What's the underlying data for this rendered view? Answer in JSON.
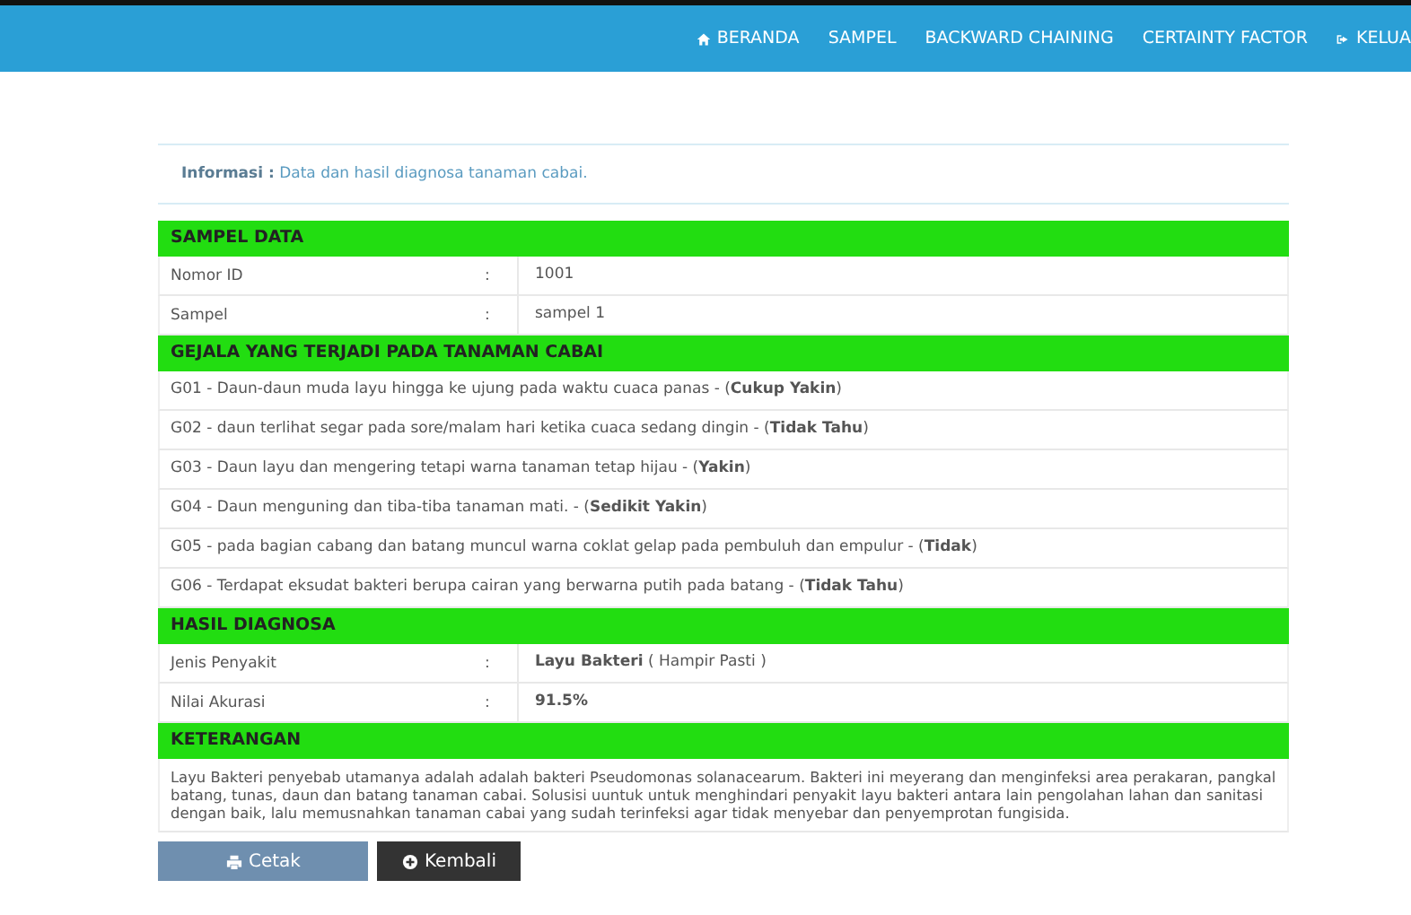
{
  "nav": [
    {
      "label": "BERANDA",
      "kind": "home"
    },
    {
      "label": "SAMPEL",
      "kind": "plain"
    },
    {
      "label": "BACKWARD CHAINING",
      "kind": "plain"
    },
    {
      "label": "CERTAINTY FACTOR",
      "kind": "plain"
    },
    {
      "label": "KELUA",
      "kind": "logout"
    }
  ],
  "info": {
    "label": "Informasi :",
    "text": "Data dan hasil diagnosa tanaman cabai."
  },
  "sampel": {
    "title": "SAMPEL DATA",
    "rows": [
      {
        "label": "Nomor ID",
        "sep": ":",
        "value": "1001"
      },
      {
        "label": "Sampel",
        "sep": ":",
        "value": "sampel 1"
      }
    ]
  },
  "gejala": {
    "title": "GEJALA YANG TERJADI PADA TANAMAN CABAI",
    "items": [
      "G01 - Daun-daun muda layu hingga ke ujung pada waktu cuaca panas - (**Cukup Yakin**)",
      "G02 - daun terlihat segar pada sore/malam hari ketika cuaca sedang dingin - (**Tidak Tahu**)",
      "G03 - Daun layu dan mengering tetapi warna tanaman tetap hijau - (**Yakin**)",
      "G04 - Daun menguning dan tiba-tiba tanaman mati. - (**Sedikit Yakin**)",
      "G05 - pada bagian cabang dan batang muncul warna coklat gelap pada pembuluh dan empulur - (**Tidak**)",
      "G06 - Terdapat eksudat bakteri berupa cairan yang berwarna putih pada batang - (**Tidak Tahu**)"
    ]
  },
  "hasil": {
    "title": "HASIL DIAGNOSA",
    "rows": [
      {
        "label": "Jenis Penyakit",
        "sep": ":",
        "value": "**Layu Bakteri** ( Hampir Pasti )"
      },
      {
        "label": "Nilai Akurasi",
        "sep": ":",
        "value": "**91.5%**"
      }
    ]
  },
  "keterangan": {
    "title": "KETERANGAN",
    "text": "Layu Bakteri penyebab utamanya adalah adalah bakteri Pseudomonas solanacearum. Bakteri ini meyerang dan menginfeksi area perakaran, pangkal batang, tunas, daun dan batang tanaman cabai. Solusisi uuntuk untuk menghindari penyakit layu bakteri antara lain pengolahan lahan dan sanitasi dengan baik, lalu memusnahkan tanaman cabai yang sudah terinfeksi agar tidak menyebar dan penyemprotan fungisida."
  },
  "buttons": [
    {
      "label": "Cetak",
      "kind": "print"
    },
    {
      "label": "Kembali",
      "kind": "back"
    }
  ]
}
